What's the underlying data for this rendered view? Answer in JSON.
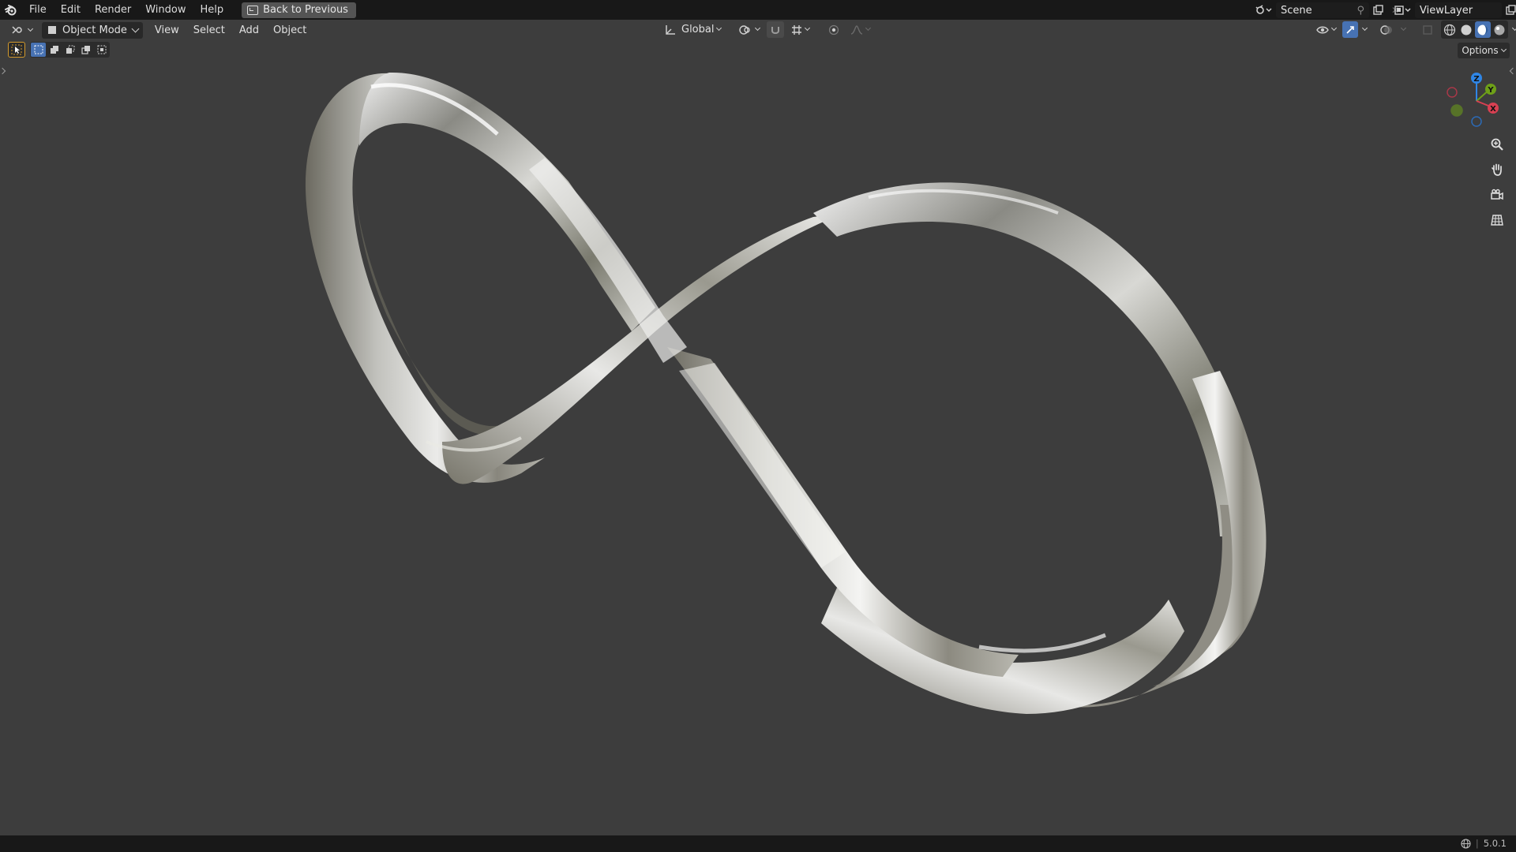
{
  "topbar": {
    "menu": [
      "File",
      "Edit",
      "Render",
      "Window",
      "Help"
    ],
    "back_button": "Back to Previous",
    "scene": "Scene",
    "view_layer": "ViewLayer"
  },
  "header": {
    "mode": "Object Mode",
    "menus": [
      "View",
      "Select",
      "Add",
      "Object"
    ],
    "transform_orientation": "Global",
    "options_label": "Options"
  },
  "gizmo": {
    "axes": {
      "x": "X",
      "y": "Y",
      "z": "Z"
    },
    "colors": {
      "x": "#d84052",
      "y": "#6ea018",
      "z": "#2f86e6"
    }
  },
  "nav_icons": [
    "zoom-icon",
    "pan-hand-icon",
    "camera-view-icon",
    "ortho-grid-icon"
  ],
  "statusbar": {
    "version": "5.0.1"
  },
  "theme": {
    "viewport_bg": "#3d3d3d",
    "topbar_bg": "#181818",
    "accent": "#4772b3"
  }
}
